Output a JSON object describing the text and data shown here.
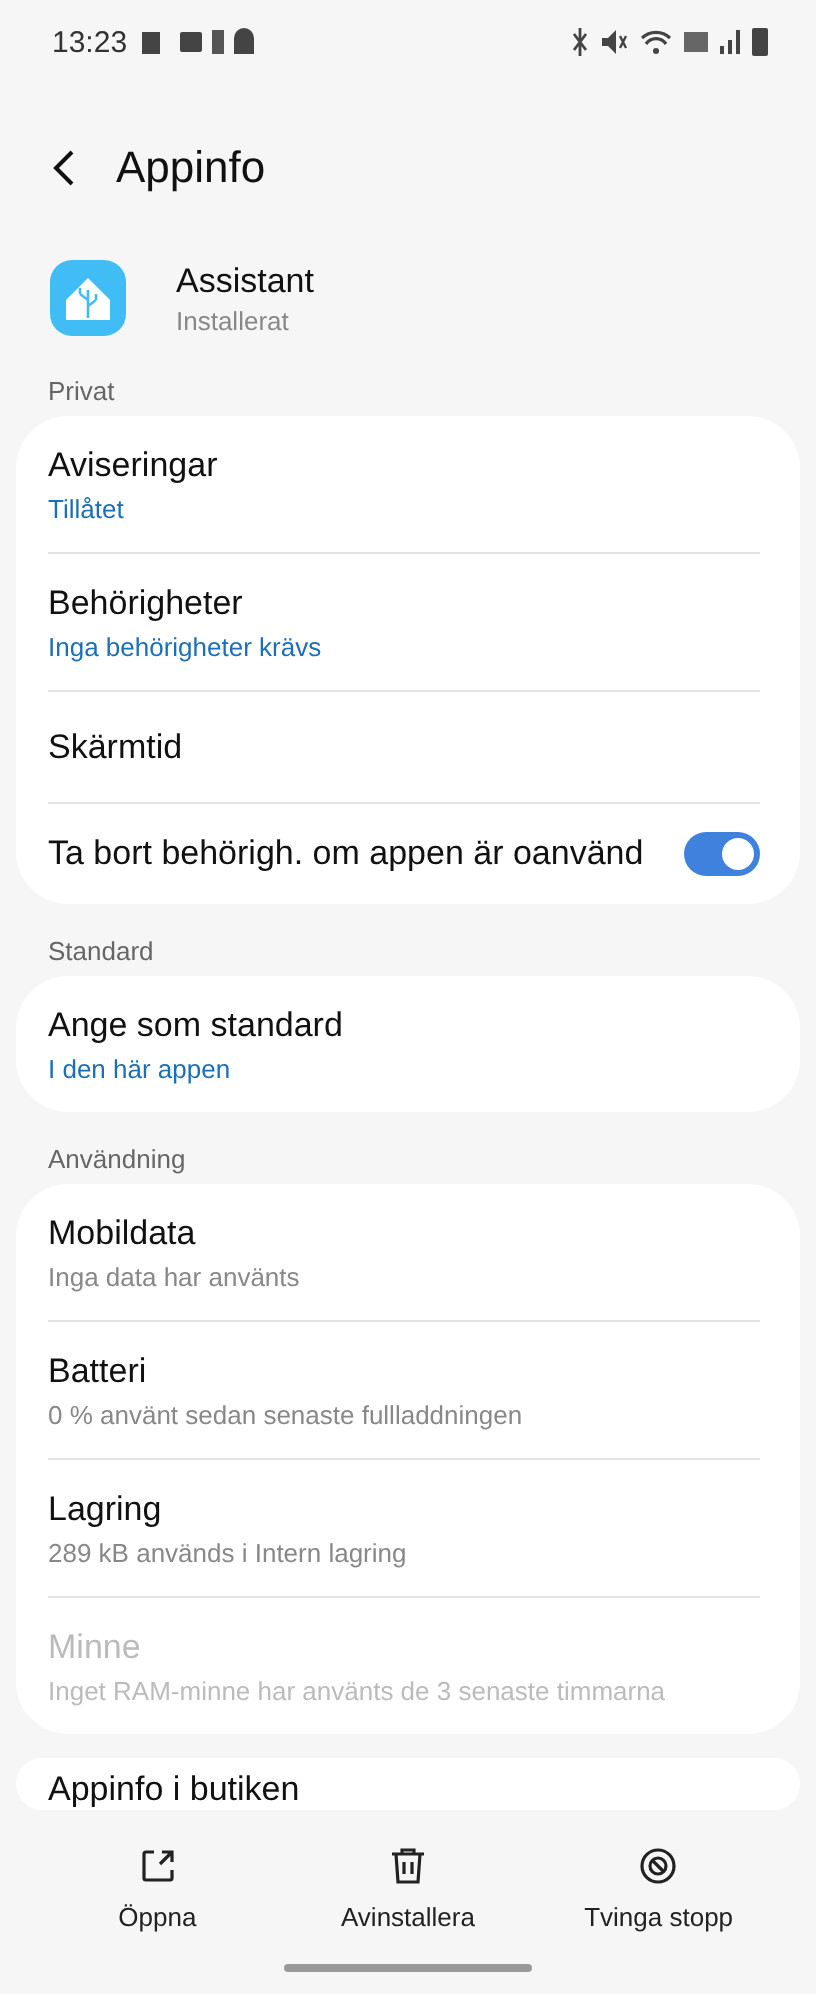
{
  "status_bar": {
    "time": "13:23"
  },
  "header": {
    "title": "Appinfo"
  },
  "app": {
    "name": "Assistant",
    "status": "Installerat"
  },
  "sections": [
    {
      "label": "Privat",
      "items": [
        {
          "kind": "text",
          "title": "Aviseringar",
          "subtitle": "Tillåtet",
          "highlighted": true,
          "disabled": false
        },
        {
          "kind": "text",
          "title": "Behörigheter",
          "subtitle": "Inga behörigheter krävs",
          "highlighted": true,
          "disabled": false
        },
        {
          "kind": "text",
          "title": "Skärmtid",
          "disabled": false
        },
        {
          "kind": "toggle",
          "title": "Ta bort behörigh. om appen är oanvänd",
          "on": true,
          "disabled": false
        }
      ]
    },
    {
      "label": "Standard",
      "items": [
        {
          "kind": "text",
          "title": "Ange som standard",
          "subtitle": "I den här appen",
          "highlighted": true,
          "disabled": false
        }
      ]
    },
    {
      "label": "Användning",
      "items": [
        {
          "kind": "text",
          "title": "Mobildata",
          "subtitle": "Inga data har använts",
          "highlighted": false,
          "disabled": false
        },
        {
          "kind": "text",
          "title": "Batteri",
          "subtitle": "0 % använt sedan senaste fullladdningen",
          "highlighted": false,
          "disabled": false
        },
        {
          "kind": "text",
          "title": "Lagring",
          "subtitle": "289 kB används i Intern lagring",
          "highlighted": false,
          "disabled": false
        },
        {
          "kind": "text",
          "title": "Minne",
          "subtitle": "Inget RAM-minne har använts de 3 senaste timmarna",
          "highlighted": false,
          "disabled": true
        }
      ]
    },
    {
      "items": [
        {
          "kind": "text",
          "title": "Appinfo i butiken",
          "disabled": false
        }
      ]
    }
  ],
  "actions": [
    {
      "kind": "open",
      "label": "Öppna"
    },
    {
      "kind": "uninstall",
      "label": "Avinstallera"
    },
    {
      "kind": "stop",
      "label": "Tvinga stopp"
    }
  ]
}
